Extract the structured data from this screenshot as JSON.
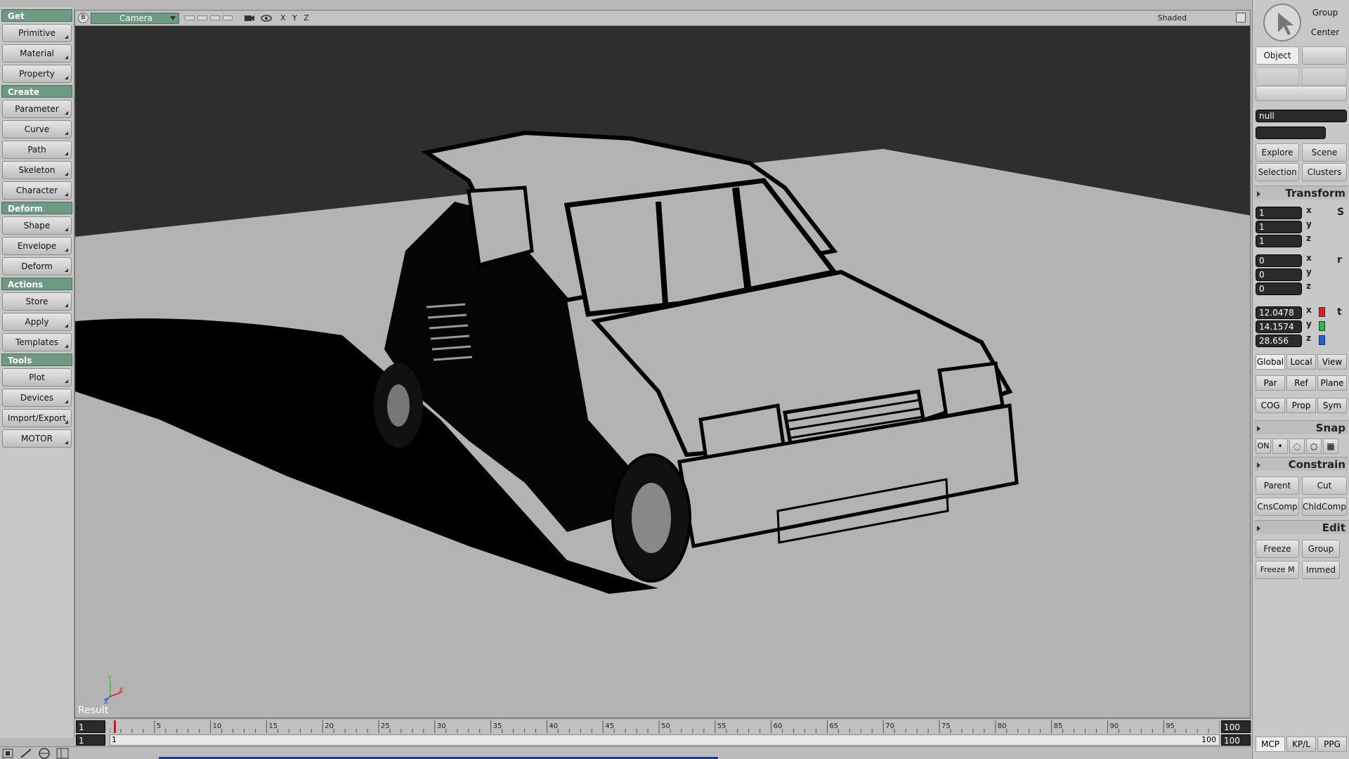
{
  "left_panel": {
    "sections": [
      {
        "title": "Get",
        "items": [
          "Primitive",
          "Material",
          "Property"
        ]
      },
      {
        "title": "Create",
        "items": [
          "Parameter",
          "Curve",
          "Path",
          "Skeleton",
          "Character"
        ]
      },
      {
        "title": "Deform",
        "items": [
          "Shape",
          "Envelope",
          "Deform"
        ]
      },
      {
        "title": "Actions",
        "items": [
          "Store",
          "Apply",
          "Templates"
        ]
      },
      {
        "title": "Tools",
        "items": [
          "Plot",
          "Devices",
          "Import/Export",
          "MOTOR"
        ]
      }
    ]
  },
  "viewport": {
    "b_button": "B",
    "camera": "Camera",
    "axes": "X Y Z",
    "shading": "Shaded",
    "result_label": "Result",
    "gizmo": {
      "y": "Y",
      "z": "Z",
      "x": "X"
    }
  },
  "timeline": {
    "start_frame": "1",
    "end_frame": "100",
    "range_start": "1",
    "range_end": "100",
    "range_end_box": "100",
    "range_start_label": "1",
    "ticks": [
      "5",
      "10",
      "15",
      "20",
      "25",
      "30",
      "35",
      "40",
      "45",
      "50",
      "55",
      "60",
      "65",
      "70",
      "75",
      "80",
      "85",
      "90",
      "95"
    ],
    "current_frame": 1
  },
  "right_panel": {
    "group": "Group",
    "center": "Center",
    "object": "Object",
    "name_field": "null",
    "explore": "Explore",
    "scene": "Scene",
    "selection": "Selection",
    "clusters": "Clusters",
    "transform_header": "Transform",
    "scale": [
      "1",
      "1",
      "1"
    ],
    "scale_letter": "S",
    "rotation": [
      "0",
      "0",
      "0"
    ],
    "rotation_letter": "r",
    "translation": [
      "12.0478",
      "14.1574",
      "28.656"
    ],
    "translation_letter": "t",
    "axis_labels": [
      "x",
      "y",
      "z"
    ],
    "axis_chip_colors": [
      "#e02020",
      "#20c040",
      "#2060e0"
    ],
    "ref_row1": [
      "Global",
      "Local",
      "View"
    ],
    "ref_row2": [
      "Par",
      "Ref",
      "Plane"
    ],
    "ref_row3": [
      "COG",
      "Prop",
      "Sym"
    ],
    "snap_header": "Snap",
    "snap_on": "ON",
    "constrain_header": "Constrain",
    "parent": "Parent",
    "cut": "Cut",
    "cnscomp": "CnsComp",
    "chldcomp": "ChldComp",
    "edit_header": "Edit",
    "freeze": "Freeze",
    "edit_group": "Group",
    "freeze_m": "Freeze M",
    "immed": "Immed",
    "bottom_tabs": [
      "MCP",
      "KP/L",
      "PPG"
    ]
  }
}
